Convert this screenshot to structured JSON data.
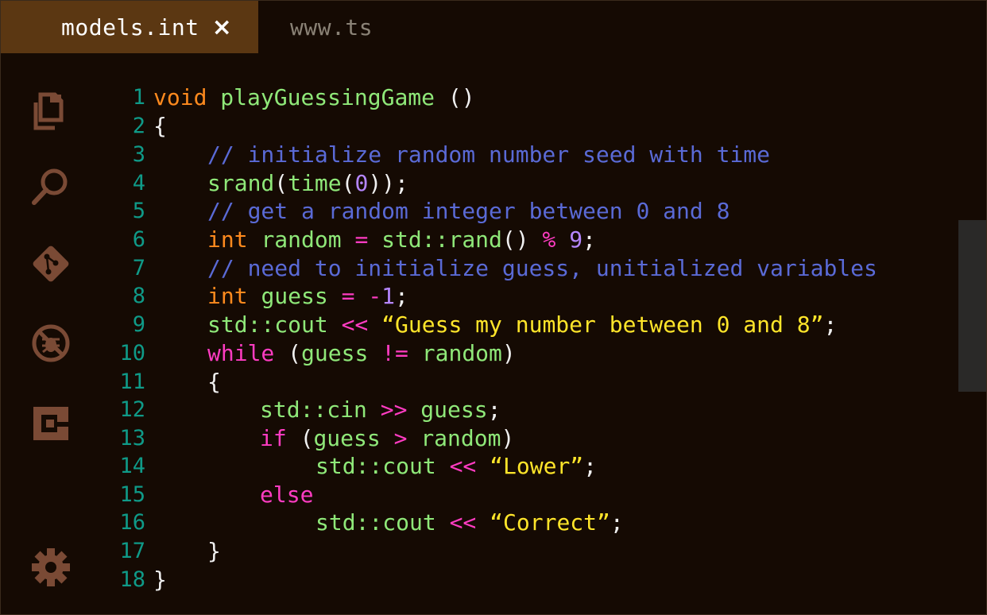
{
  "tabs": [
    {
      "label": "models.int",
      "active": true,
      "close": "×"
    },
    {
      "label": "www.ts",
      "active": false
    }
  ],
  "activity_bar": [
    "explorer-icon",
    "search-icon",
    "source-control-icon",
    "debug-icon",
    "extensions-icon",
    "settings-icon"
  ],
  "colors": {
    "background": "#150a03",
    "active_tab": "#5b3712",
    "icon": "#7a4a35",
    "line_number": "#0f9a88",
    "type": "#ff8a1e",
    "identifier": "#8fe879",
    "comment": "#5a6ad6",
    "operator": "#ff3cc2",
    "number": "#b586ff",
    "string": "#ffe52a"
  },
  "code": {
    "lines": [
      {
        "n": "1",
        "indent": 0,
        "tokens": [
          [
            "type",
            "void"
          ],
          [
            "p",
            " "
          ],
          [
            "fn",
            "playGuessingGame"
          ],
          [
            "p",
            " ()"
          ]
        ]
      },
      {
        "n": "2",
        "indent": 0,
        "tokens": [
          [
            "p",
            "{"
          ]
        ]
      },
      {
        "n": "3",
        "indent": 1,
        "tokens": [
          [
            "cm",
            "// initialize random number seed with time"
          ]
        ]
      },
      {
        "n": "4",
        "indent": 1,
        "tokens": [
          [
            "id",
            "srand"
          ],
          [
            "p",
            "("
          ],
          [
            "id",
            "time"
          ],
          [
            "p",
            "("
          ],
          [
            "num",
            "0"
          ],
          [
            "p",
            "));"
          ]
        ]
      },
      {
        "n": "5",
        "indent": 1,
        "tokens": [
          [
            "cm",
            "// get a random integer between 0 and 8"
          ]
        ]
      },
      {
        "n": "6",
        "indent": 1,
        "tokens": [
          [
            "type",
            "int"
          ],
          [
            "p",
            " "
          ],
          [
            "id",
            "random"
          ],
          [
            "p",
            " "
          ],
          [
            "op",
            "="
          ],
          [
            "p",
            " "
          ],
          [
            "id",
            "std::rand"
          ],
          [
            "p",
            "() "
          ],
          [
            "op",
            "%"
          ],
          [
            "p",
            " "
          ],
          [
            "num",
            "9"
          ],
          [
            "p",
            ";"
          ]
        ]
      },
      {
        "n": "7",
        "indent": 1,
        "tokens": [
          [
            "cm",
            "// need to initialize guess, unitialized variables"
          ]
        ]
      },
      {
        "n": "8",
        "indent": 1,
        "tokens": [
          [
            "type",
            "int"
          ],
          [
            "p",
            " "
          ],
          [
            "id",
            "guess"
          ],
          [
            "p",
            " "
          ],
          [
            "op",
            "="
          ],
          [
            "p",
            " "
          ],
          [
            "op",
            "-"
          ],
          [
            "num",
            "1"
          ],
          [
            "p",
            ";"
          ]
        ]
      },
      {
        "n": "9",
        "indent": 1,
        "tokens": [
          [
            "id",
            "std::cout"
          ],
          [
            "p",
            " "
          ],
          [
            "op",
            "<<"
          ],
          [
            "p",
            " "
          ],
          [
            "str",
            "“Guess my number between 0 and 8”"
          ],
          [
            "p",
            ";"
          ]
        ]
      },
      {
        "n": "10",
        "indent": 1,
        "tokens": [
          [
            "kw",
            "while"
          ],
          [
            "p",
            " ("
          ],
          [
            "id",
            "guess"
          ],
          [
            "p",
            " "
          ],
          [
            "op",
            "!="
          ],
          [
            "p",
            " "
          ],
          [
            "id",
            "random"
          ],
          [
            "p",
            ")"
          ]
        ]
      },
      {
        "n": "11",
        "indent": 1,
        "tokens": [
          [
            "p",
            "{"
          ]
        ]
      },
      {
        "n": "12",
        "indent": 2,
        "tokens": [
          [
            "id",
            "std::cin"
          ],
          [
            "p",
            " "
          ],
          [
            "op",
            ">>"
          ],
          [
            "p",
            " "
          ],
          [
            "id",
            "guess"
          ],
          [
            "p",
            ";"
          ]
        ]
      },
      {
        "n": "13",
        "indent": 2,
        "tokens": [
          [
            "kw",
            "if"
          ],
          [
            "p",
            " ("
          ],
          [
            "id",
            "guess"
          ],
          [
            "p",
            " "
          ],
          [
            "op",
            ">"
          ],
          [
            "p",
            " "
          ],
          [
            "id",
            "random"
          ],
          [
            "p",
            ")"
          ]
        ]
      },
      {
        "n": "14",
        "indent": 3,
        "tokens": [
          [
            "id",
            "std::cout"
          ],
          [
            "p",
            " "
          ],
          [
            "op",
            "<<"
          ],
          [
            "p",
            " "
          ],
          [
            "str",
            "“Lower”"
          ],
          [
            "p",
            ";"
          ]
        ]
      },
      {
        "n": "15",
        "indent": 2,
        "tokens": [
          [
            "kw",
            "else"
          ]
        ]
      },
      {
        "n": "16",
        "indent": 3,
        "tokens": [
          [
            "id",
            "std::cout"
          ],
          [
            "p",
            " "
          ],
          [
            "op",
            "<<"
          ],
          [
            "p",
            " "
          ],
          [
            "str",
            "“Correct”"
          ],
          [
            "p",
            ";"
          ]
        ]
      },
      {
        "n": "17",
        "indent": 1,
        "tokens": [
          [
            "p",
            "}"
          ]
        ]
      },
      {
        "n": "18",
        "indent": 0,
        "tokens": [
          [
            "p",
            "}"
          ]
        ]
      }
    ]
  }
}
